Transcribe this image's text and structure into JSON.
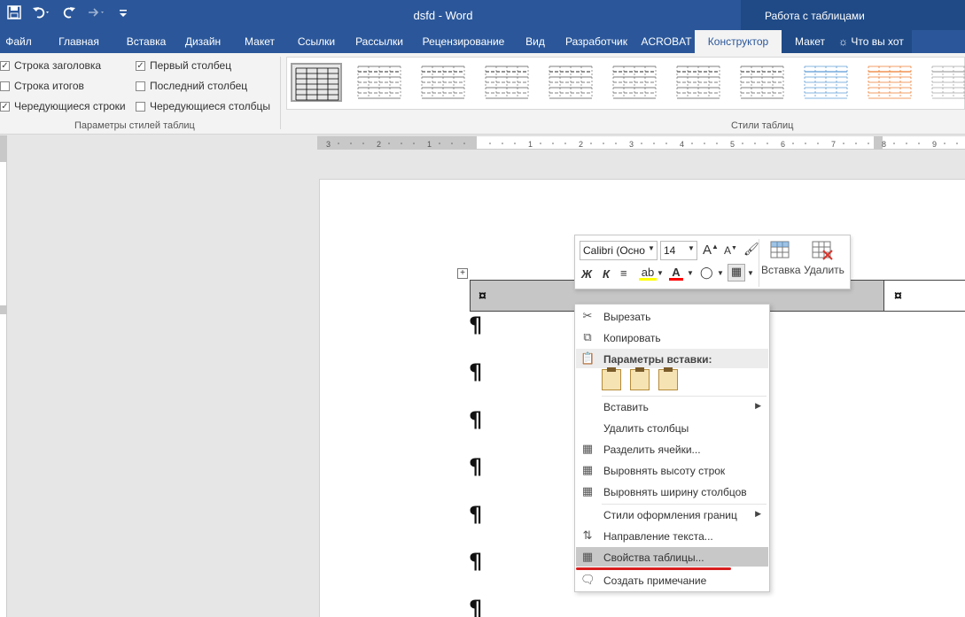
{
  "titlebar": {
    "doc_title": "dsfd - Word",
    "context_group": "Работа с таблицами"
  },
  "tabs": [
    {
      "label": "Файл"
    },
    {
      "label": "Главная"
    },
    {
      "label": "Вставка"
    },
    {
      "label": "Дизайн"
    },
    {
      "label": "Макет"
    },
    {
      "label": "Ссылки"
    },
    {
      "label": "Рассылки"
    },
    {
      "label": "Рецензирование"
    },
    {
      "label": "Вид"
    },
    {
      "label": "Разработчик"
    },
    {
      "label": "ACROBAT"
    },
    {
      "label": "Конструктор",
      "active": true
    },
    {
      "label": "Макет"
    },
    {
      "label": "Что вы хот"
    }
  ],
  "table_style_options": {
    "items": [
      {
        "label": "Строка заголовка",
        "checked": true
      },
      {
        "label": "Строка итогов",
        "checked": false
      },
      {
        "label": "Чередующиеся строки",
        "checked": true
      },
      {
        "label": "Первый столбец",
        "checked": true
      },
      {
        "label": "Последний столбец",
        "checked": false
      },
      {
        "label": "Чередующиеся столбцы",
        "checked": false
      }
    ],
    "group_label": "Параметры стилей таблиц"
  },
  "table_styles": {
    "group_label": "Стили таблиц",
    "colors": [
      "#000000",
      "#555555",
      "#555555",
      "#555555",
      "#555555",
      "#555555",
      "#555555",
      "#555555",
      "#5b9bd5",
      "#ed7d31",
      "#a5a5a5"
    ]
  },
  "mini_toolbar": {
    "font_name": "Calibri (Осно",
    "font_size": "14",
    "bold": "Ж",
    "italic": "К",
    "insert_label": "Вставка",
    "delete_label": "Удалить",
    "highlight_color": "#ffff00",
    "font_color": "#ff0000"
  },
  "context_menu": {
    "cut": "Вырезать",
    "copy": "Копировать",
    "paste_options": "Параметры вставки:",
    "insert": "Вставить",
    "delete_columns": "Удалить столбцы",
    "split_cells": "Разделить ячейки...",
    "distribute_rows": "Выровнять высоту строк",
    "distribute_columns": "Выровнять ширину столбцов",
    "border_styles": "Стили оформления границ",
    "text_direction": "Направление текста...",
    "table_properties": "Свойства таблицы...",
    "new_comment": "Создать примечание"
  },
  "document": {
    "cell_mark": "¤",
    "pilcrow": "¶"
  }
}
